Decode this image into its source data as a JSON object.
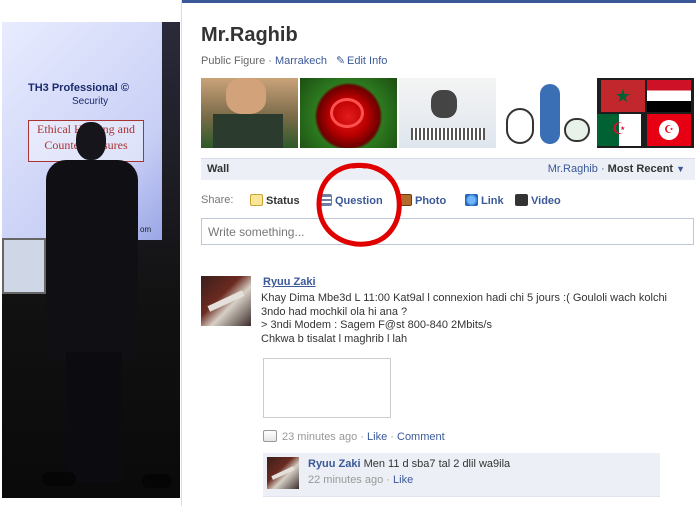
{
  "profile": {
    "name": "Mr.Raghib",
    "category": "Public Figure",
    "location": "Marrakech",
    "edit_info_label": "Edit Info",
    "slide": {
      "brand": "TH3 Professional",
      "brand_mark": "©",
      "brand_sub": "Security",
      "box_line1": "Ethical Hacking and",
      "box_line2": "Countermeasures",
      "footer": "om"
    }
  },
  "photos": [
    {
      "name": "photo-footballer"
    },
    {
      "name": "photo-red-rose"
    },
    {
      "name": "photo-man-barcode"
    },
    {
      "name": "photo-cartoon"
    },
    {
      "name": "photo-flags"
    }
  ],
  "wall": {
    "title": "Wall",
    "filter_owner": "Mr.Raghib",
    "filter_separator": "·",
    "filter_mode": "Most Recent"
  },
  "share": {
    "label": "Share:",
    "options": [
      "Status",
      "Question",
      "Photo",
      "Link",
      "Video"
    ],
    "composer_placeholder": "Write something..."
  },
  "story": {
    "author": "Ryuu Zaki",
    "lines": [
      "Khay Dima Mbe3d L 11:00 Kat9al l connexion hadi chi 5 jours :( Gouloli wach kolchi",
      "3ndo had mochkil ola hi ana ?",
      "> 3ndi Modem : Sagem F@st 800-840 2Mbits/s",
      "Chkwa b tisalat l maghrib l lah"
    ],
    "time": "23 minutes ago",
    "separator": "·",
    "like_label": "Like",
    "comment_label": "Comment"
  },
  "comment": {
    "author": "Ryuu Zaki",
    "text": "Men 11 d sba7 tal 2 dlil wa9ila",
    "time": "22 minutes ago",
    "separator": "·",
    "like_label": "Like"
  },
  "colors": {
    "brand_blue": "#3b5998",
    "highlight_red": "#e00000"
  }
}
